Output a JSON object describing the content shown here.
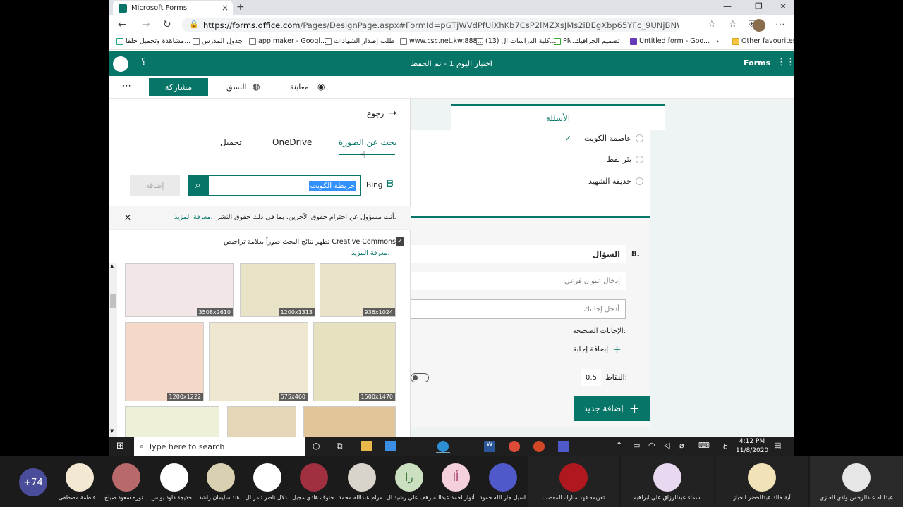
{
  "browser": {
    "tab_title": "Microsoft Forms",
    "tab_close": "×",
    "new_tab": "+",
    "url_domain": "https://forms.office.com",
    "url_path": "/Pages/DesignPage.aspx#FormId=pGTjWVdPfUiXhKb7CsP2lMZXsJMs2iBEgXbp65YFc_9UNjBNWUdFQzI3Nk...",
    "bookmarks": [
      "مشاهدة وتحميل حلقا...",
      "جدول المدرس",
      "app maker - Googl...",
      "طلب إصدار الشهادات",
      "www.csc.net.kw:888...",
      "(13) كلية الدراسات ال...",
      "PN...",
      "تصميم الجرافيك",
      "Untitled form - Goo...",
      "Other favourites"
    ]
  },
  "forms": {
    "brand": "Forms",
    "title": "اختبار اليوم 1 - تم الحفظ",
    "help": "؟",
    "share": "مشاركة",
    "theme": "النسق",
    "preview": "معاينة",
    "more": "⋯"
  },
  "panel": {
    "back": "رجوع",
    "tabs": [
      "تحميل",
      "OneDrive",
      "بحث عن الصورة"
    ],
    "bing": "Bing",
    "search_value": "خريطة الكويت",
    "add": "إضافة",
    "notice": "أنت مسؤول عن احترام حقوق الآخرين، بما في ذلك حقوق النشر.",
    "notice_link": "معرفة المزيد.",
    "cc_text": "تظهر نتائج البحث صوراً بعلامة تراخيص Creative Commons.",
    "cc_link": "معرفة المزيد.",
    "images": [
      "3508x2610",
      "1200x1313",
      "936x1024",
      "1200x1222",
      "575x460",
      "1500x1470",
      "",
      "",
      ""
    ]
  },
  "form": {
    "questions_tab": "الأسئلة",
    "options": [
      "عاصمة الكويت",
      "بئر نفط",
      "حديقة الشهيد"
    ],
    "q_number": "8.",
    "q_label": "السؤال",
    "subtitle_ph": "إدخال عنوان فرعي",
    "answer_ph": "أدخل إجابتك",
    "correct_answers": "الإجابات الصحيحة:",
    "add_answer": "إضافة إجابة",
    "points_label": "النقاط:",
    "points_value": "0.5",
    "add_new": "إضافة جديد"
  },
  "taskbar": {
    "search": "Type here to search",
    "lang": "ع",
    "time": "4:12 PM",
    "date": "11/8/2020"
  },
  "meeting": {
    "overflow": "+74",
    "participants": [
      "فاطمة مصطفى...",
      "نوره سعود صياح...",
      "خديجة داود يونس...",
      "هند سليمان راشد...",
      "ذلال ناصر ثامر ال...",
      "جنوف هادي مجبل...",
      "مرام عبدالله محمد...",
      "رهف علي رشيد ال...",
      "أنوار احمد عبدالله...",
      "اسيل جار الله حمود...",
      "تغريمه فهد مبارك المعصب",
      "اسماء عبدالرزاق علي ابراهيم",
      "آية خالد عبدالخضر الخباز",
      "عبدالله عبدالرحمن وادي العنزي"
    ]
  }
}
